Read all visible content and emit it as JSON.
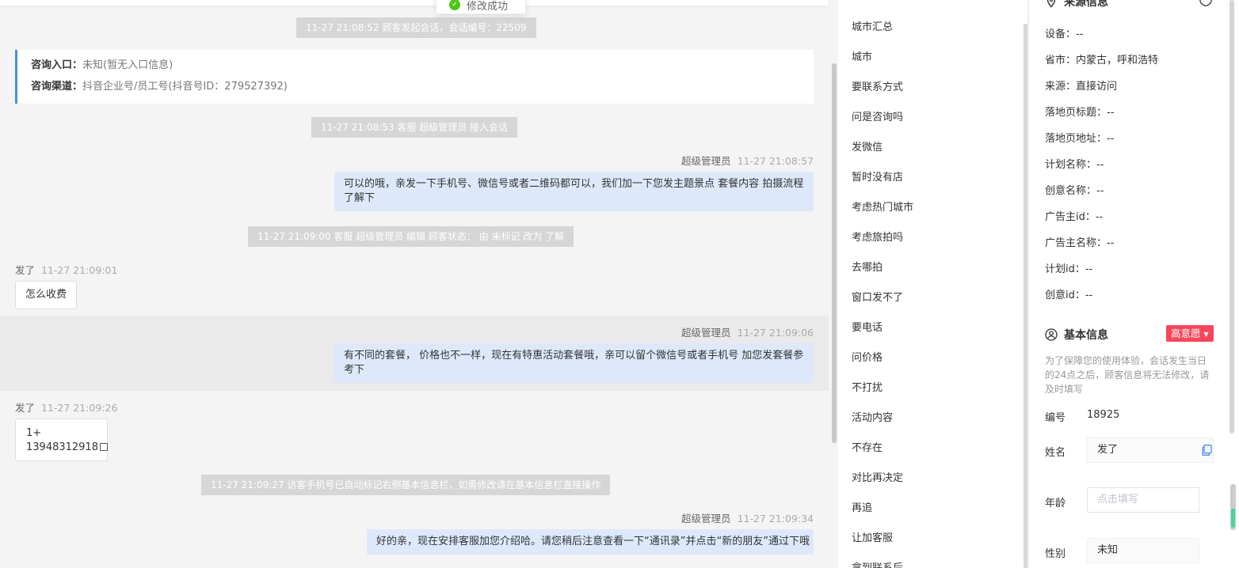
{
  "toast": {
    "text": "修改成功"
  },
  "chat": {
    "sys1": "11-27 21:08:52 顾客发起会话，会话编号：22509",
    "source": {
      "entry_label": "咨询入口：",
      "entry_value": "未知(暂无入口信息)",
      "channel_label": "咨询渠道：",
      "channel_value": "抖音企业号/员工号(抖音号ID：279527392)"
    },
    "sys2": "11-27 21:08:53 客服 超级管理员 接入会话",
    "msg1": {
      "sender": "超级管理员",
      "time": "11-27 21:08:57",
      "text": "可以的哦，亲发一下手机号、微信号或者二维码都可以，我们加一下您发主题景点 套餐内容 拍摄流程了解下"
    },
    "sys3": "11-27 21:09:00 客服 超级管理员 编辑 顾客状态： 由 未标记 改为 了解",
    "msg2": {
      "sender": "发了",
      "time": "11-27 21:09:01",
      "text": "怎么收费"
    },
    "msg3": {
      "sender": "超级管理员",
      "time": "11-27 21:09:06",
      "text": "有不同的套餐， 价格也不一样，现在有特惠活动套餐哦，亲可以留个微信号或者手机号 加您发套餐参考下"
    },
    "msg4": {
      "sender": "发了",
      "time": "11-27 21:09:26",
      "line1": "1+",
      "line2": "13948312918"
    },
    "sys4": "11-27 21:09:27 访客手机号已自动标记右侧基本信息栏，如需修改请在基本信息栏直接操作",
    "msg5": {
      "sender": "超级管理员",
      "time": "11-27 21:09:34",
      "text": "好的亲，现在安排客服加您介绍哈。请您稍后注意查看一下“通讯录”并点击“新的朋友”通过下哦"
    }
  },
  "quick_replies": [
    "城市汇总",
    "城市",
    "要联系方式",
    "问是咨询吗",
    "发微信",
    "暂时没有店",
    "考虑热门城市",
    "考虑旅拍吗",
    "去哪拍",
    "窗口发不了",
    "要电话",
    "问价格",
    "不打扰",
    "活动内容",
    "不存在",
    "对比再决定",
    "再追",
    "让加客服",
    "拿到联系后"
  ],
  "source_info": {
    "title": "来源信息",
    "rows": [
      "设备：--",
      "省市：内蒙古，呼和浩特",
      "来源：直接访问",
      "落地页标题：--",
      "落地页地址：--",
      "计划名称：--",
      "创意名称：--",
      "广告主id：--",
      "广告主名称：--",
      "计划id：--",
      "创意id：--"
    ]
  },
  "basic_info": {
    "title": "基本信息",
    "intent": "高意愿",
    "tip": "为了保障您的使用体验，会话发生当日的24点之后，顾客信息将无法修改，请及时填写",
    "id_label": "编号",
    "id_value": "18925",
    "name_label": "姓名",
    "name_value": "发了",
    "age_label": "年龄",
    "age_placeholder": "点击填写",
    "gender_label": "性别",
    "gender_value": "未知"
  }
}
